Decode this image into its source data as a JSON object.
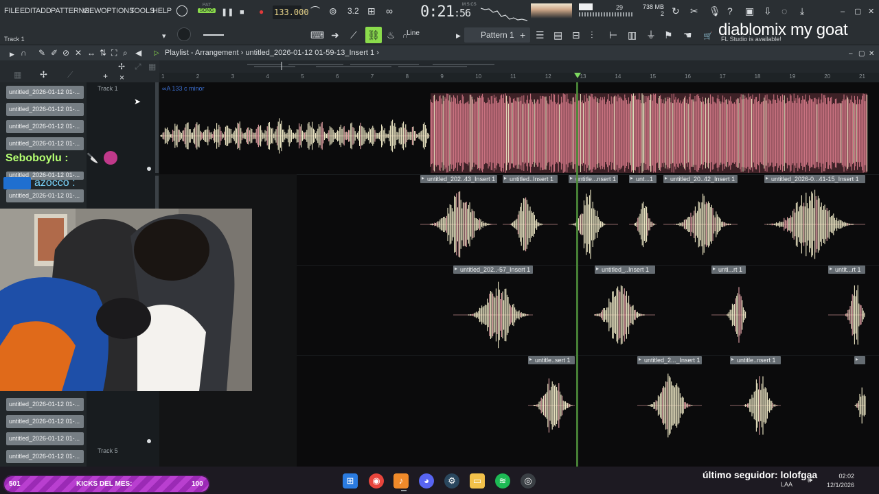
{
  "menu": {
    "items": [
      "FILE",
      "EDIT",
      "ADD",
      "PATTERNS",
      "VIEW",
      "OPTIONS",
      "TOOLS",
      "HELP"
    ]
  },
  "transport": {
    "pat_label": "PAT",
    "song_label": "SONG",
    "tempo": "133.000",
    "time_main": "0:21",
    "time_sub": ":56",
    "time_unit": "M:S:CS",
    "cpu": "29",
    "memory": "738 MB",
    "memory_sub": "2"
  },
  "toolbar": {
    "hint_track": "Track 1",
    "snap_mode": "Line",
    "pattern": "Pattern 1",
    "news": "FL Studio is available!"
  },
  "overlay_text": "diablomix my goat",
  "playlist": {
    "title": "Playlist - Arrangement",
    "breadcrumb": "untitled_2026-01-12 01-59-13_Insert 1",
    "key_label": "A 133 c minor",
    "tracks": [
      "Track 1",
      "Track 5"
    ],
    "ruler": [
      "1",
      "2",
      "3",
      "4",
      "5",
      "6",
      "7",
      "8",
      "9",
      "10",
      "11",
      "12",
      "13",
      "14",
      "15",
      "16",
      "17",
      "18",
      "19",
      "20",
      "21"
    ],
    "playhead_bar": 12.95,
    "picker_items": [
      "untitled_2026-01-12 01-...",
      "untitled_2026-01-12 01-...",
      "untitled_2026-01-12 01-...",
      "untitled_2026-01-12 01-...",
      "untitled_2026-01-12 01-...",
      "untitled_2026-01-12 01-...",
      "untitled_2026-01-12 01-...",
      "untitled_2026-01-12 01-...",
      "untitled_2026-01-12 01-...",
      "untitled_2026-01-12 01-..."
    ],
    "clips_row2": [
      "untitled_202..43_Insert 1",
      "untitled..Insert 1",
      "untitle...nsert 1",
      "unt...1",
      "untitled_20..42_Insert 1",
      "untitled_2026-0...41-15_Insert 1"
    ],
    "clips_row3": [
      "untitled_202..-57_Insert 1",
      "untitled_..Insert 1",
      "unti...rt 1",
      "untit...rt 1"
    ],
    "clips_row4": [
      "untitle..sert 1",
      "untitled_2..._Insert 1",
      "untitle..nsert 1",
      ""
    ]
  },
  "chat": {
    "user1": "Seboboylu :",
    "user2": "azocco :"
  },
  "stream": {
    "kicks_left": "501",
    "kicks_label": "KICKS DEL MES:",
    "kicks_right": "100",
    "follower": "último seguidor: lolofgaa"
  },
  "taskbar": {
    "time": "02:02",
    "date": "12/1/2026",
    "lang": "LAA"
  },
  "colors": {
    "accent_green": "#8bdc4c",
    "clip_header": "#656c72",
    "wave_cream": "#f3edc9",
    "wave_pink": "#e8a4a8",
    "wave_red": "#d97b8a",
    "kicks_purple": "#b93fd0"
  }
}
